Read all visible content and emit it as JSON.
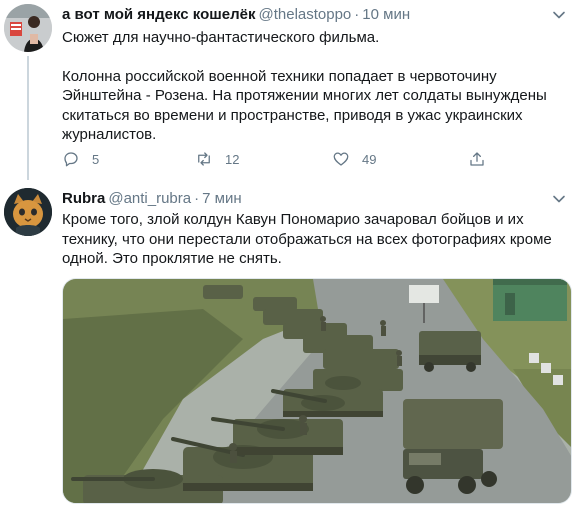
{
  "tweet1": {
    "author_name": "а вот мой яндекс кошелёк",
    "author_handle": "@thelastoppo",
    "separator": "·",
    "time": "10 мин",
    "text_line1": "Сюжет для научно-фантастического фильма.",
    "text_para2": "Колонна российской военной техники попадает в червоточину Эйнштейна - Розена. На протяжении многих лет солдаты вынуждены скитаться во времени и пространстве, приводя в ужас украинских журналистов.",
    "reply_count": "5",
    "retweet_count": "12",
    "like_count": "49",
    "icons": [
      "reply-icon",
      "retweet-icon",
      "like-icon",
      "share-icon",
      "caret-down-icon"
    ]
  },
  "tweet2": {
    "author_name": "Rubra",
    "author_handle": "@anti_rubra",
    "separator": "·",
    "time": "7 мин",
    "text": "Кроме того, злой колдун Кавун Пономарио зачаровал бойцов и их технику, что они перестали отображаться на всех фотографиях кроме одной. Это проклятие не снять."
  },
  "colors": {
    "text_primary": "#14171a",
    "text_secondary": "#657786",
    "thread_line": "#ccd6dd"
  }
}
